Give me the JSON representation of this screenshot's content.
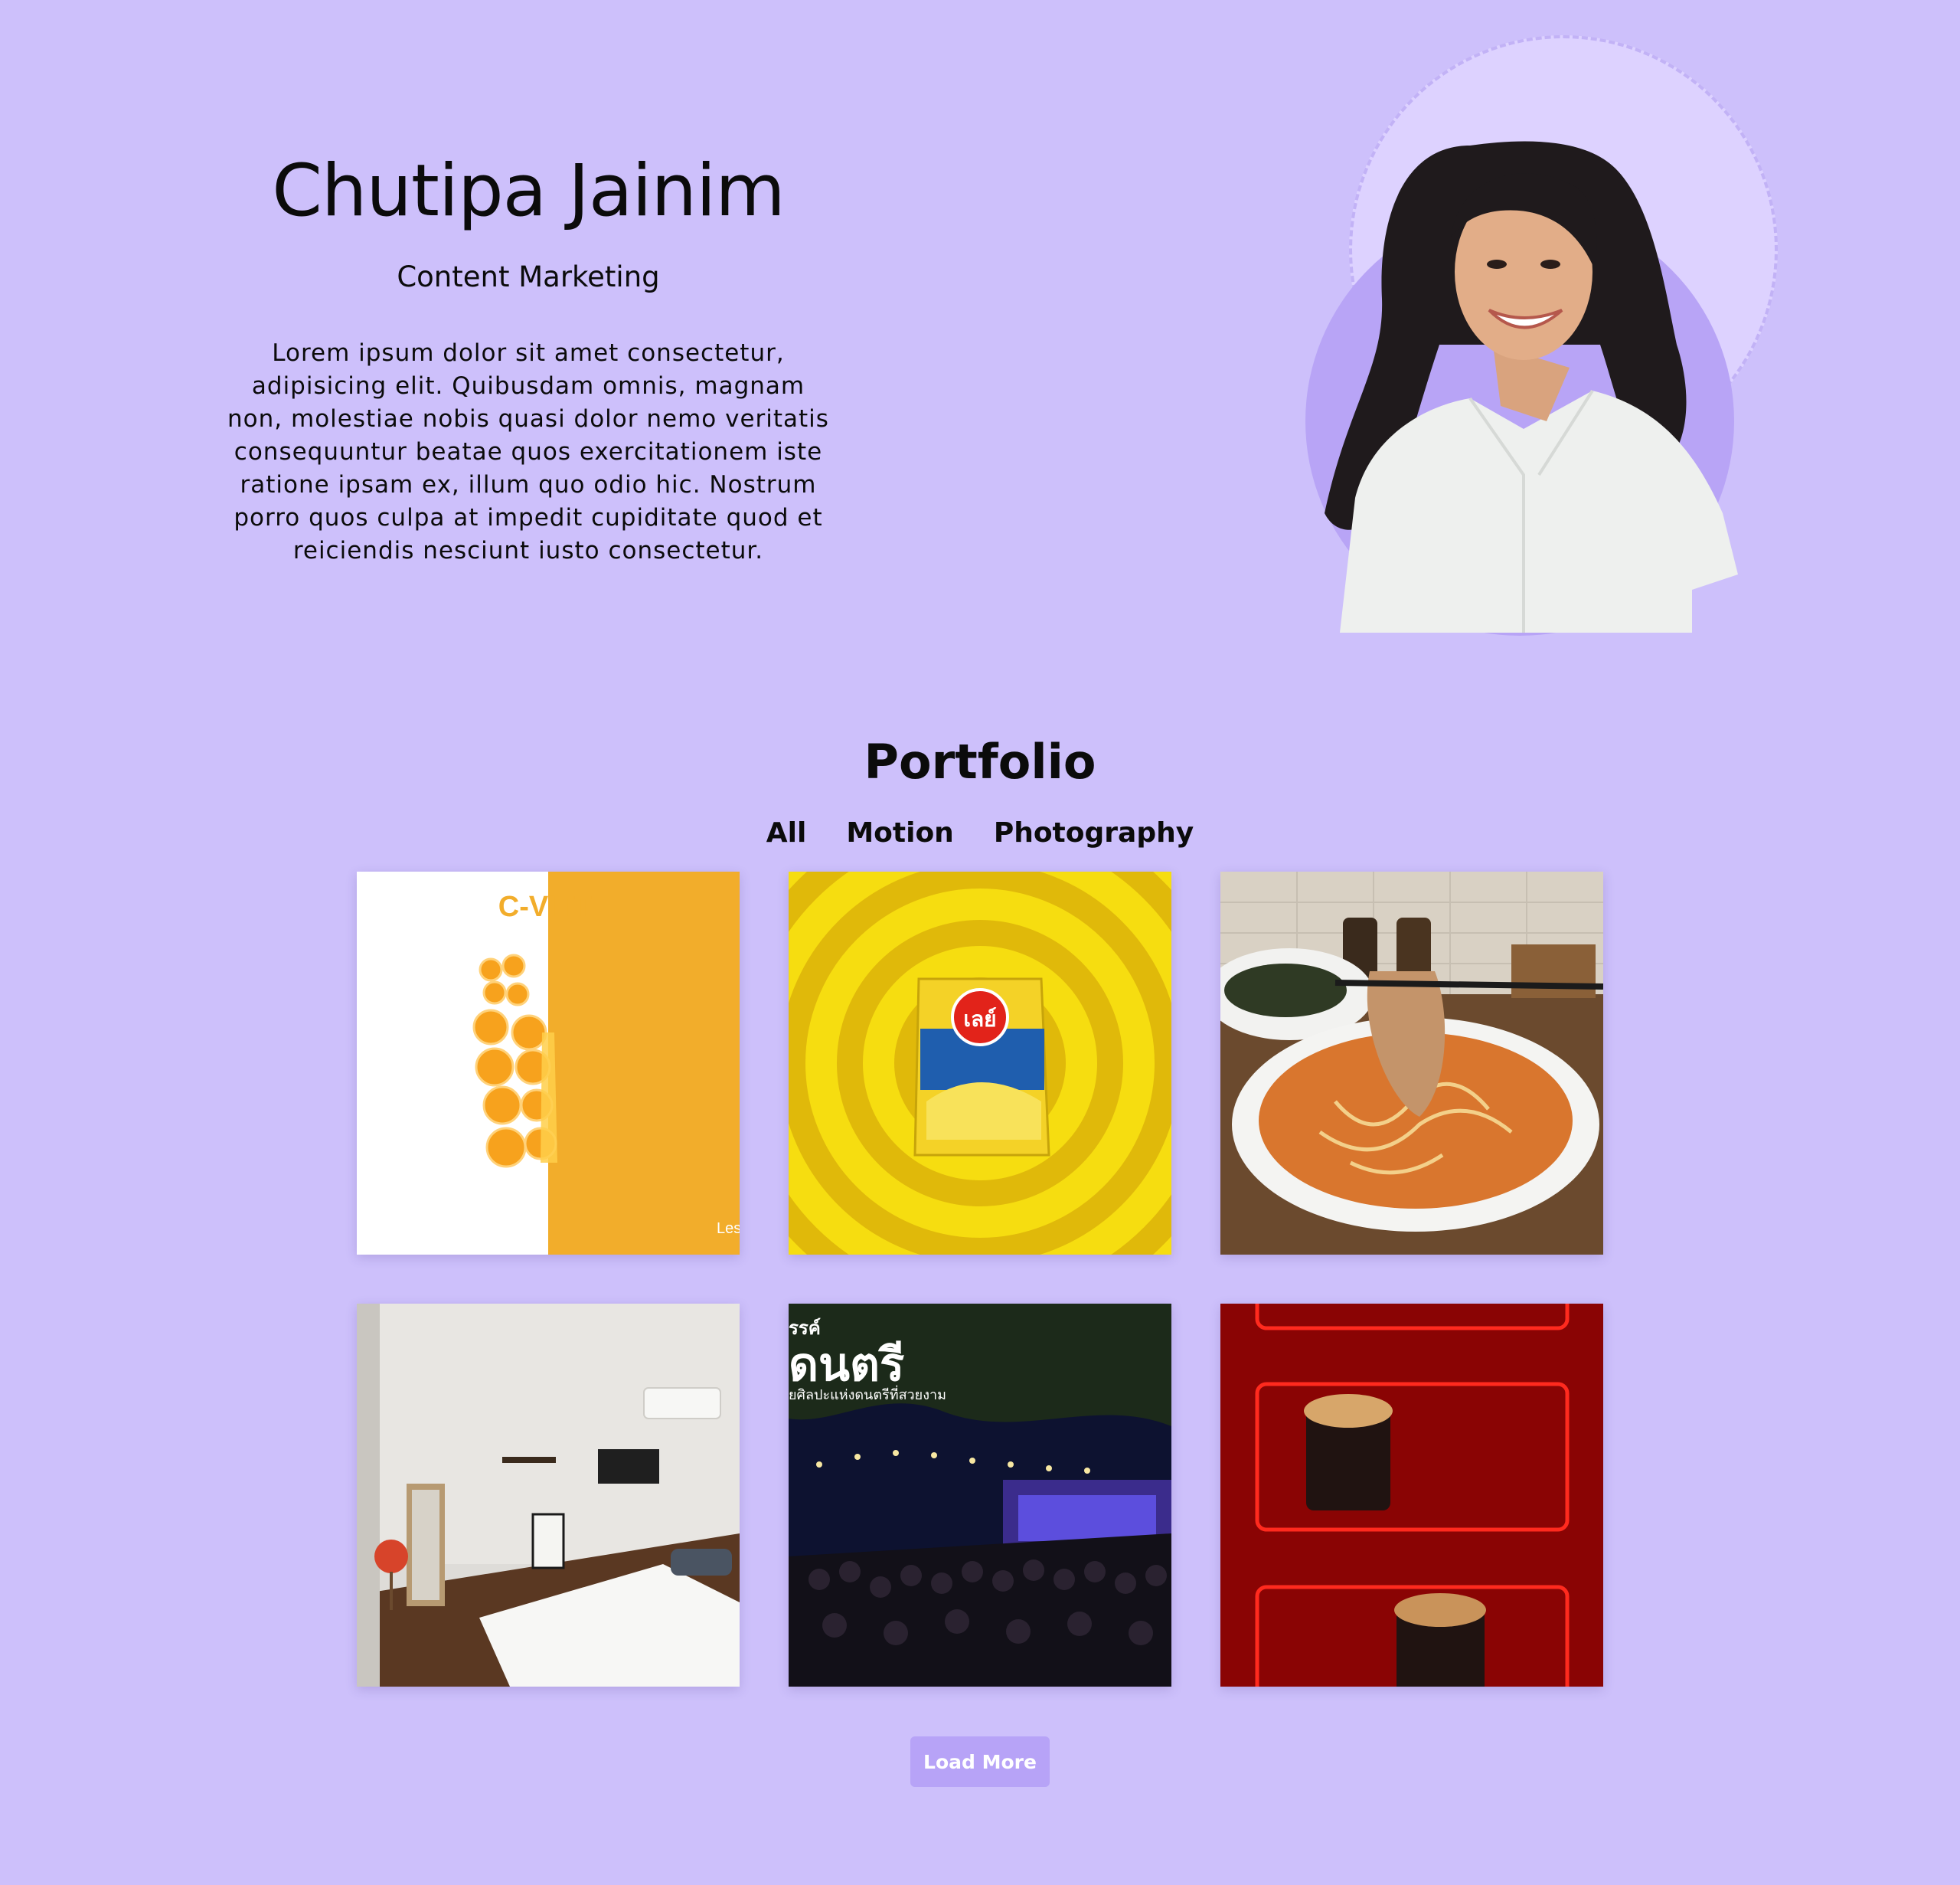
{
  "hero": {
    "name": "Chutipa Jainim",
    "role": "Content Marketing",
    "description": "Lorem ipsum dolor sit amet consectetur, adipisicing elit. Quibusdam omnis, magnam non, molestiae nobis quasi dolor nemo veritatis consequuntur beatae quos exercitationem iste ratione ipsam ex, illum quo odio hic. Nostrum porro quos culpa at impedit cupiditate quod et reiciendis nesciunt iusto consectetur."
  },
  "portfolio": {
    "title": "Portfolio",
    "filters": [
      "All",
      "Motion",
      "Photography"
    ],
    "items": [
      {
        "brand_text": "C-VITT",
        "corner_text": "Les"
      },
      {
        "brand_text": "เลย์"
      },
      {},
      {},
      {
        "headline": "ดนตรี",
        "prefix": "รรค์",
        "subline": "ยศิลปะแห่งดนตรีที่สวยงาม"
      },
      {}
    ],
    "load_more_label": "Load More"
  },
  "colors": {
    "background": "#cdc0fb",
    "accent": "#b7a3f7",
    "text": "#0b0b0b"
  }
}
